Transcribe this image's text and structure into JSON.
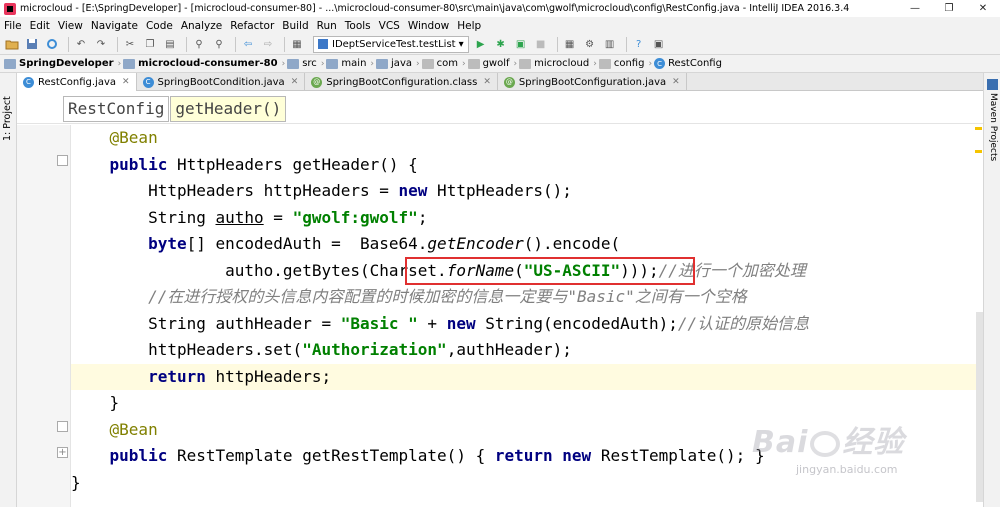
{
  "window": {
    "title": "microcloud - [E:\\SpringDeveloper] - [microcloud-consumer-80] - ...\\microcloud-consumer-80\\src\\main\\java\\com\\gwolf\\microcloud\\config\\RestConfig.java - IntelliJ IDEA 2016.3.4",
    "minimize": "—",
    "maximize": "❐",
    "close": "✕"
  },
  "menu": [
    "File",
    "Edit",
    "View",
    "Navigate",
    "Code",
    "Analyze",
    "Refactor",
    "Build",
    "Run",
    "Tools",
    "VCS",
    "Window",
    "Help"
  ],
  "toolbar": {
    "run_config": "IDeptServiceTest.testList",
    "run_config_arrow": "▾"
  },
  "navbar": {
    "items": [
      "SpringDeveloper",
      "microcloud-consumer-80",
      "src",
      "main",
      "java",
      "com",
      "gwolf",
      "microcloud",
      "config",
      "RestConfig"
    ]
  },
  "side_tabs": {
    "left": "1: Project",
    "right": "Maven Projects"
  },
  "tabs": [
    {
      "label": "RestConfig.java",
      "icon_letter": "C",
      "color": "#3d8dd6"
    },
    {
      "label": "SpringBootCondition.java",
      "icon_letter": "C",
      "color": "#3d8dd6"
    },
    {
      "label": "SpringBootConfiguration.class",
      "icon_letter": "@",
      "color": "#6aa84f"
    },
    {
      "label": "SpringBootConfiguration.java",
      "icon_letter": "@",
      "color": "#6aa84f"
    }
  ],
  "editor_breadcrumb": [
    "RestConfig",
    "getHeader()"
  ],
  "code": {
    "l1_ann": "@Bean",
    "l2_kw": "public",
    "l2_rest": " HttpHeaders getHeader() {",
    "l3_a": "HttpHeaders httpHeaders = ",
    "l3_kw": "new",
    "l3_b": " HttpHeaders();",
    "l4_a": "String ",
    "l4_var": "autho",
    "l4_b": " = ",
    "l4_str": "\"gwolf:gwolf\"",
    "l4_c": ";",
    "l5_kw": "byte",
    "l5_a": "[] encodedAuth =  Base64.",
    "l5_meth": "getEncoder",
    "l5_b": "().encode(",
    "l6_a": "autho.getBytes(Charset.",
    "l6_meth": "forName",
    "l6_b": "(",
    "l6_str": "\"US-ASCII\"",
    "l6_c": ")));",
    "l6_cmt": "//进行一个加密处理",
    "l7_cmt": "//在进行授权的头信息内容配置的时候加密的信息一定要与\"Basic\"之间有一个空格",
    "l8_a": "String authHeader = ",
    "l8_str": "\"Basic \"",
    "l8_b": " + ",
    "l8_kw": "new",
    "l8_c": " String(encodedAuth);",
    "l8_cmt": "//认证的原始信息",
    "l9_a": "httpHeaders.set(",
    "l9_str": "\"Authorization\"",
    "l9_b": ",authHeader);",
    "l10_kw": "return",
    "l10_a": " httpHeaders;",
    "l11": "}",
    "l12_ann": "@Bean",
    "l13_kw1": "public",
    "l13_a": " RestTemplate getRestTemplate() { ",
    "l13_kw2": "return",
    "l13_b": " ",
    "l13_kw3": "new",
    "l13_c": " RestTemplate(); }",
    "l14": "}"
  },
  "watermark": {
    "brand": "Bai",
    "brand_cn": "经验",
    "url": "jingyan.baidu.com"
  }
}
